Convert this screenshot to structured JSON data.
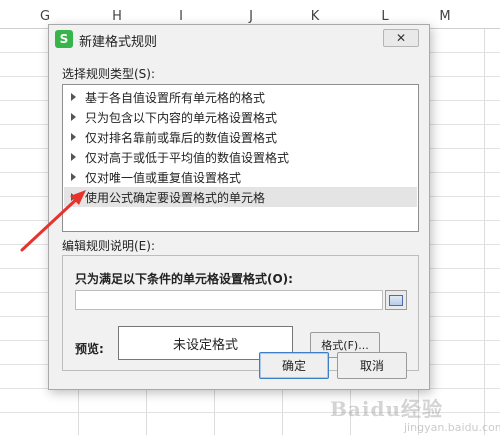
{
  "spreadsheet": {
    "columns": [
      "G",
      "H",
      "I",
      "J",
      "K",
      "L",
      "M"
    ]
  },
  "dialog": {
    "app_icon_letter": "S",
    "title": "新建格式规则",
    "close_label": "✕",
    "select_type_label": "选择规则类型(S):",
    "rule_types": [
      "基于各自值设置所有单元格的格式",
      "只为包含以下内容的单元格设置格式",
      "仅对排名靠前或靠后的数值设置格式",
      "仅对高于或低于平均值的数值设置格式",
      "仅对唯一值或重复值设置格式",
      "使用公式确定要设置格式的单元格"
    ],
    "selected_rule_index": 5,
    "edit_desc_label": "编辑规则说明(E):",
    "formula_heading": "只为满足以下条件的单元格设置格式(O):",
    "formula_value": "",
    "preview_label": "预览:",
    "preview_text": "未设定格式",
    "format_button": "格式(F)...",
    "ok_button": "确定",
    "cancel_button": "取消"
  },
  "annotation": {
    "arrow_color": "#e8322c"
  },
  "watermark": {
    "text": "Baidu经验",
    "sub": "jingyan.baidu.com"
  }
}
